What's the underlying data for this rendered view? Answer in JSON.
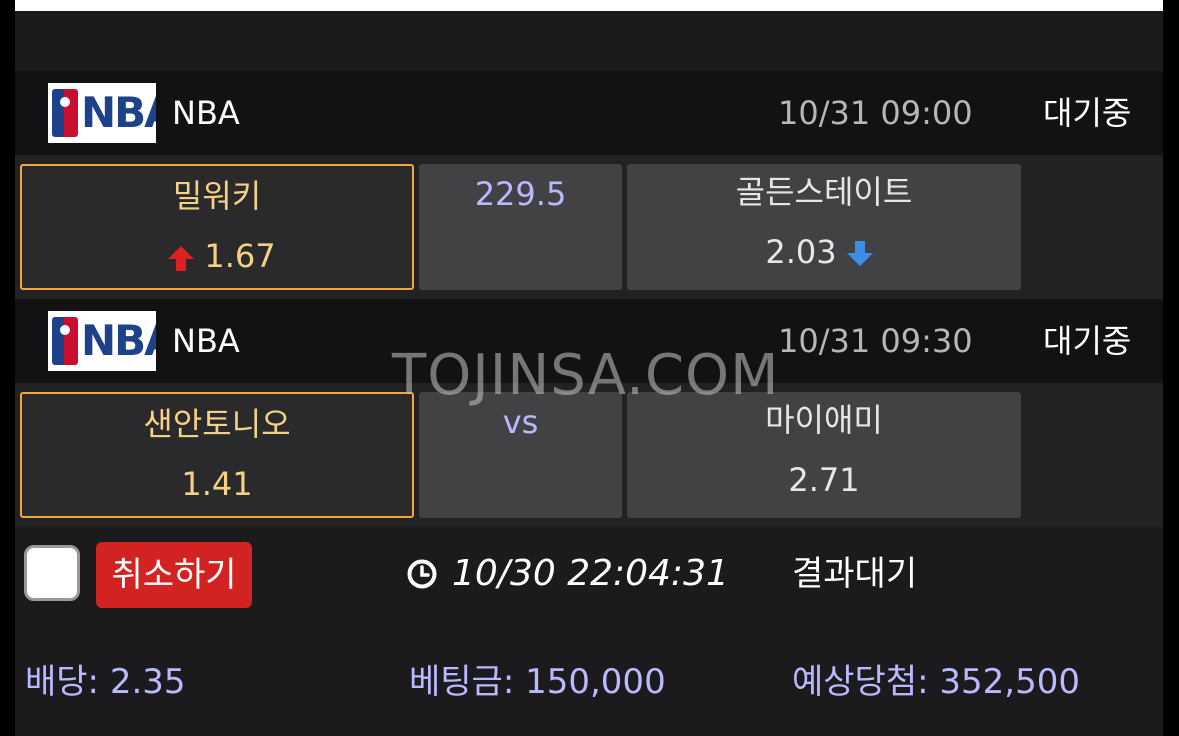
{
  "matches": [
    {
      "league": "NBA",
      "time": "10/31 09:00",
      "status": "대기중",
      "home": {
        "team": "밀워키",
        "odds": "1.67",
        "trend": "up"
      },
      "middle": "229.5",
      "away": {
        "team": "골든스테이트",
        "odds": "2.03",
        "trend": "down"
      }
    },
    {
      "league": "NBA",
      "time": "10/31 09:30",
      "status": "대기중",
      "home": {
        "team": "샌안토니오",
        "odds": "1.41"
      },
      "middle": "vs",
      "away": {
        "team": "마이애미",
        "odds": "2.71"
      }
    }
  ],
  "watermark": "TOJINSA.COM",
  "bet": {
    "cancel_label": "취소하기",
    "time": "10/30 22:04:31",
    "result": "결과대기",
    "odds": "배당: 2.35",
    "amount": "베팅금: 150,000",
    "expected": "예상당첨: 352,500"
  },
  "logo_text": "NBA",
  "icons": {
    "up": "up-arrow-icon",
    "down": "down-arrow-icon",
    "clock": "clock-icon"
  },
  "colors": {
    "selected_border": "#f2a73b",
    "selected_text": "#f4d283",
    "up": "#e02020",
    "down": "#3a8ee6",
    "cancel": "#d32222",
    "accent_text": "#b9b9ff"
  }
}
